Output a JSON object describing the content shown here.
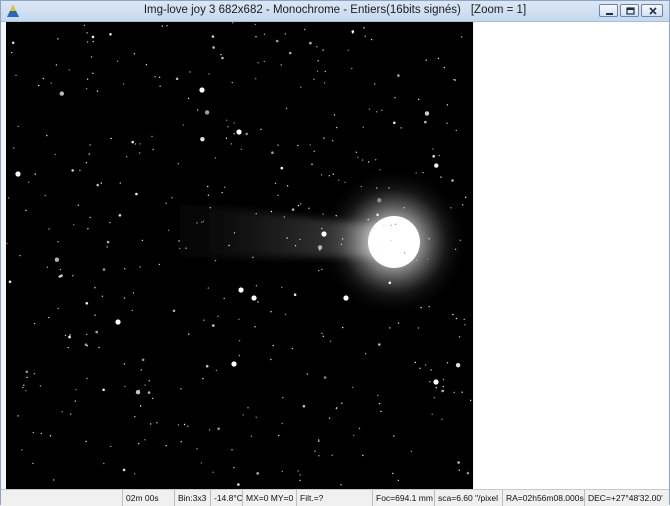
{
  "window": {
    "title": "Img-love joy 3 682x682 - Monochrome - Entiers(16bits signés)",
    "zoom": "[Zoom = 1]",
    "icons": [
      "app-logo-icon",
      "minimize-icon",
      "restore-icon",
      "close-icon"
    ]
  },
  "image": {
    "subject": "comet",
    "mode": "Monochrome"
  },
  "statusbar": {
    "exposure": "02m 00s",
    "binning": "Bin:3x3",
    "temperature": "-14.8°C",
    "mouse": "MX=0 MY=0",
    "filter": "Filt.=?",
    "focal": "Foc=694.1 mm",
    "scale": "sca=6.60 \"/pixel",
    "ra": "RA=02h56m08.000s",
    "dec": "DEC=+27°48'32.00'"
  },
  "colors": {
    "titlebar": "#c6d8ef",
    "image_background": "#000000",
    "statusbar": "#f0f0f0"
  }
}
